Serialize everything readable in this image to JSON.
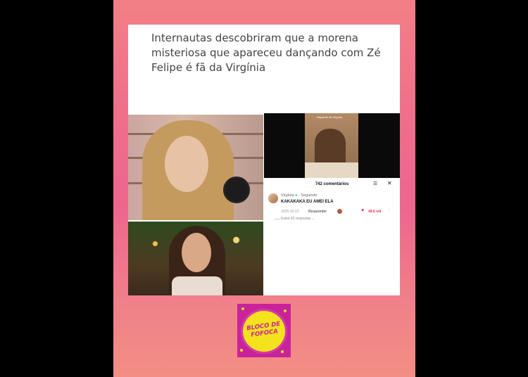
{
  "headline": "Internautas descobriram que a morena misteriosa que apareceu dançando com Zé Felipe é fã da Virgínia",
  "video": {
    "overlay_text": "...flagrante da Virgínia"
  },
  "comments": {
    "count_label": "742 comentários",
    "filter_icon": "sort-icon",
    "close_label": "✕",
    "author": "Virgínia",
    "verified_icon": "●",
    "following": "· Seguindo",
    "text": "KAKAKAKA EU AMEI ELA",
    "date": "2025-10-13",
    "reply_label": "Responder",
    "heart_icon": "♥",
    "likes": "49,6 mil",
    "comment_icon": "◌",
    "more_replies": "Exibir 62 respostas ⌄"
  },
  "logo": {
    "line1": "BLOCO DE",
    "line2": "FOFOCA"
  },
  "colors": {
    "panel_top": "#f27f86",
    "panel_mid": "#ee668d",
    "logo_bg": "#c8239a",
    "logo_yellow": "#f3e21c",
    "like_red": "#e8334f"
  }
}
